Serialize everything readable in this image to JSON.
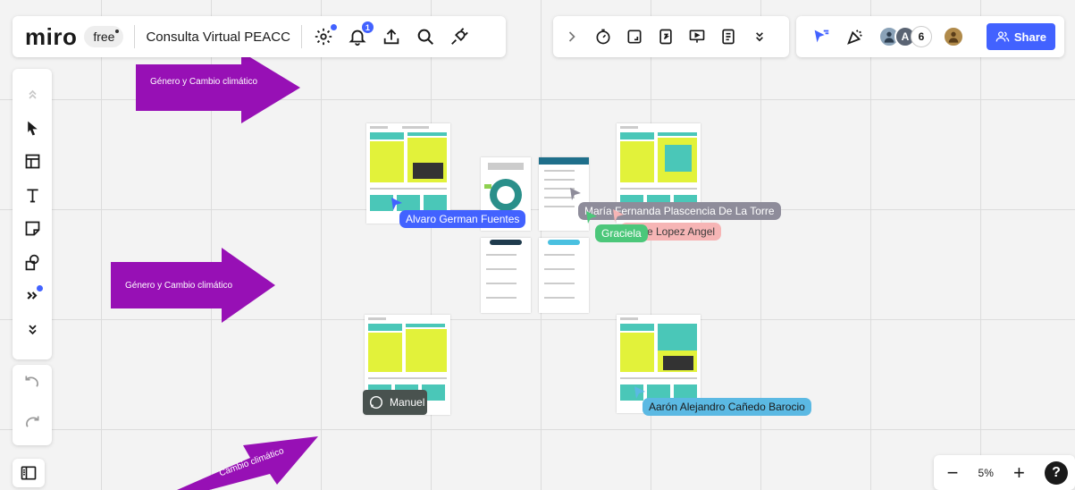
{
  "app": {
    "logo": "miro",
    "plan": "free",
    "board_name": "Consulta Virtual PEACC",
    "notifications_count": "1"
  },
  "collaborators": {
    "avatar_initial": "A",
    "count": "6"
  },
  "share_label": "Share",
  "canvas": {
    "arrows": [
      {
        "label": "Género y Cambio climático"
      },
      {
        "label": "Género y Cambio climático"
      },
      {
        "label": "Cambio climático"
      }
    ]
  },
  "cursors": [
    {
      "name": "Alvaro German Fuentes",
      "color": "#4262ff"
    },
    {
      "name": "María Fernanda Plascencia De La Torre",
      "color": "#8e8c9a"
    },
    {
      "name": "Graciela",
      "color": "#4cc77a"
    },
    {
      "name": "e Lopez Angel",
      "color": "#f6b5b5"
    },
    {
      "name": "Manuel",
      "color": "#49524f"
    },
    {
      "name": "Aarón Alejandro Cañedo Barocio",
      "color": "#5bb9e3"
    }
  ],
  "zoom": {
    "level": "5%",
    "minus": "−",
    "plus": "+",
    "help": "?"
  },
  "colors": {
    "accent": "#4262ff",
    "arrow_purple": "#9710b5",
    "card_yellow": "#e2f23a",
    "card_teal": "#4ac7b8"
  },
  "icons": {
    "settings": "gear-icon",
    "notifications": "bell-icon",
    "upload": "upload-icon",
    "search": "search-icon",
    "plugin": "plug-icon"
  }
}
